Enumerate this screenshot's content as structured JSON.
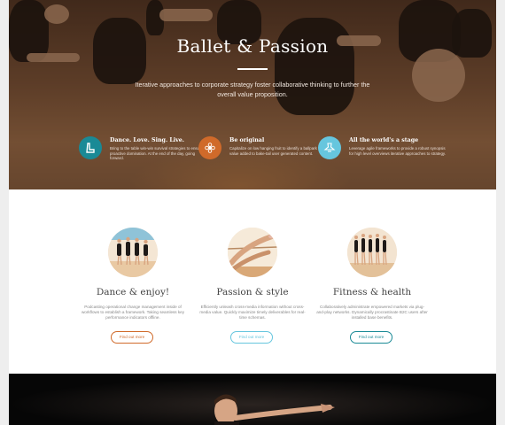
{
  "hero": {
    "title": "Ballet & Passion",
    "subtitle": "Iterative approaches to corporate strategy foster collaborative thinking to further the overall value proposition."
  },
  "features": [
    {
      "icon": "boot-icon",
      "title": "Dance. Love. Sing. Live.",
      "text": "Bring to the table win-win survival strategies to ensure proactive domination. At the end of the day, going forward.",
      "color": "#1a8a96"
    },
    {
      "icon": "flower-icon",
      "title": "Be original",
      "text": "Capitalize on low hanging fruit to identify a ballpark value added to bake-tail user generated content.",
      "color": "#d06a2a"
    },
    {
      "icon": "tutu-icon",
      "title": "All the world's a stage",
      "text": "Leverage agile frameworks to provide a robust synopsis for high level overviews iterative approaches to strategy.",
      "color": "#66c6de"
    }
  ],
  "services": [
    {
      "title": "Dance & enjoy!",
      "text": "Podcasting operational change management inside of workflows to establish a framework. Taking seamless key performance indicators offline.",
      "button": "Find out more",
      "color": "#d06a2a"
    },
    {
      "title": "Passion & style",
      "text": "Efficiently unleash cross-media information without cross-media value. Quickly maximize timely deliverables for real-time schemas.",
      "button": "Find out more",
      "color": "#66c6de"
    },
    {
      "title": "Fitness & health",
      "text": "Collaboratively administrate empowered markets via plug-and-play networks. Dynamically procrastinate B2C users after installed base benefits.",
      "button": "Find out more",
      "color": "#1a8a96"
    }
  ]
}
